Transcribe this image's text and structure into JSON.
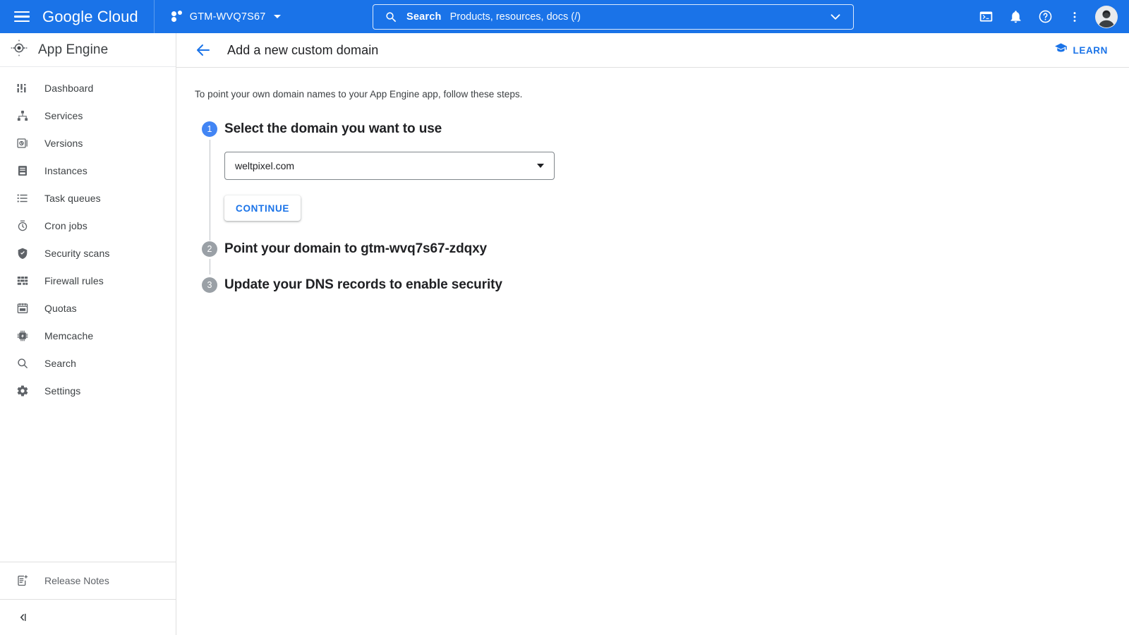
{
  "topbar": {
    "menu_icon": "hamburger-menu-icon",
    "brand": "Google Cloud",
    "project_icon": "project-dots-icon",
    "project_name": "GTM-WVQ7S67",
    "project_caret": "chevron-down-icon",
    "search": {
      "icon": "search-icon",
      "label": "Search",
      "placeholder": "Products, resources, docs (/)",
      "expand_icon": "chevron-down-icon"
    },
    "icons": [
      {
        "name": "cloud-shell-icon",
        "title": "Activate Cloud Shell"
      },
      {
        "name": "notifications-bell-icon",
        "title": "Notifications"
      },
      {
        "name": "help-question-icon",
        "title": "Help"
      },
      {
        "name": "more-vertical-icon",
        "title": "More options"
      }
    ],
    "avatar": "user-avatar"
  },
  "sidebar": {
    "product_icon": "app-engine-icon",
    "product_title": "App Engine",
    "items": [
      {
        "label": "Dashboard",
        "icon": "dashboard-icon"
      },
      {
        "label": "Services",
        "icon": "services-icon"
      },
      {
        "label": "Versions",
        "icon": "versions-icon"
      },
      {
        "label": "Instances",
        "icon": "instances-icon"
      },
      {
        "label": "Task queues",
        "icon": "task-queues-icon"
      },
      {
        "label": "Cron jobs",
        "icon": "cron-jobs-icon"
      },
      {
        "label": "Security scans",
        "icon": "security-scans-icon"
      },
      {
        "label": "Firewall rules",
        "icon": "firewall-rules-icon"
      },
      {
        "label": "Quotas",
        "icon": "quotas-icon"
      },
      {
        "label": "Memcache",
        "icon": "memcache-icon"
      },
      {
        "label": "Search",
        "icon": "search-icon"
      },
      {
        "label": "Settings",
        "icon": "settings-gear-icon"
      }
    ],
    "release_notes": {
      "label": "Release Notes",
      "icon": "release-notes-icon"
    },
    "collapse": {
      "icon": "collapse-panel-icon"
    }
  },
  "page": {
    "back_icon": "back-arrow-icon",
    "title": "Add a new custom domain",
    "learn": {
      "label": "LEARN",
      "icon": "graduation-cap-icon"
    },
    "intro": "To point your own domain names to your App Engine app, follow these steps."
  },
  "steps": [
    {
      "number": "1",
      "state": "active",
      "title": "Select the domain you want to use",
      "domain_select": {
        "value": "weltpixel.com",
        "caret": "chevron-down-icon"
      },
      "continue_label": "CONTINUE"
    },
    {
      "number": "2",
      "state": "inactive",
      "title": "Point your domain to gtm-wvq7s67-zdqxy"
    },
    {
      "number": "3",
      "state": "inactive",
      "title": "Update your DNS records to enable security"
    }
  ],
  "colors": {
    "brand_blue": "#1a73e8",
    "step_active": "#4285f4",
    "step_inactive": "#9aa0a6",
    "text_primary": "#202124",
    "text_secondary": "#5f6368",
    "border": "#e0e0e0"
  }
}
